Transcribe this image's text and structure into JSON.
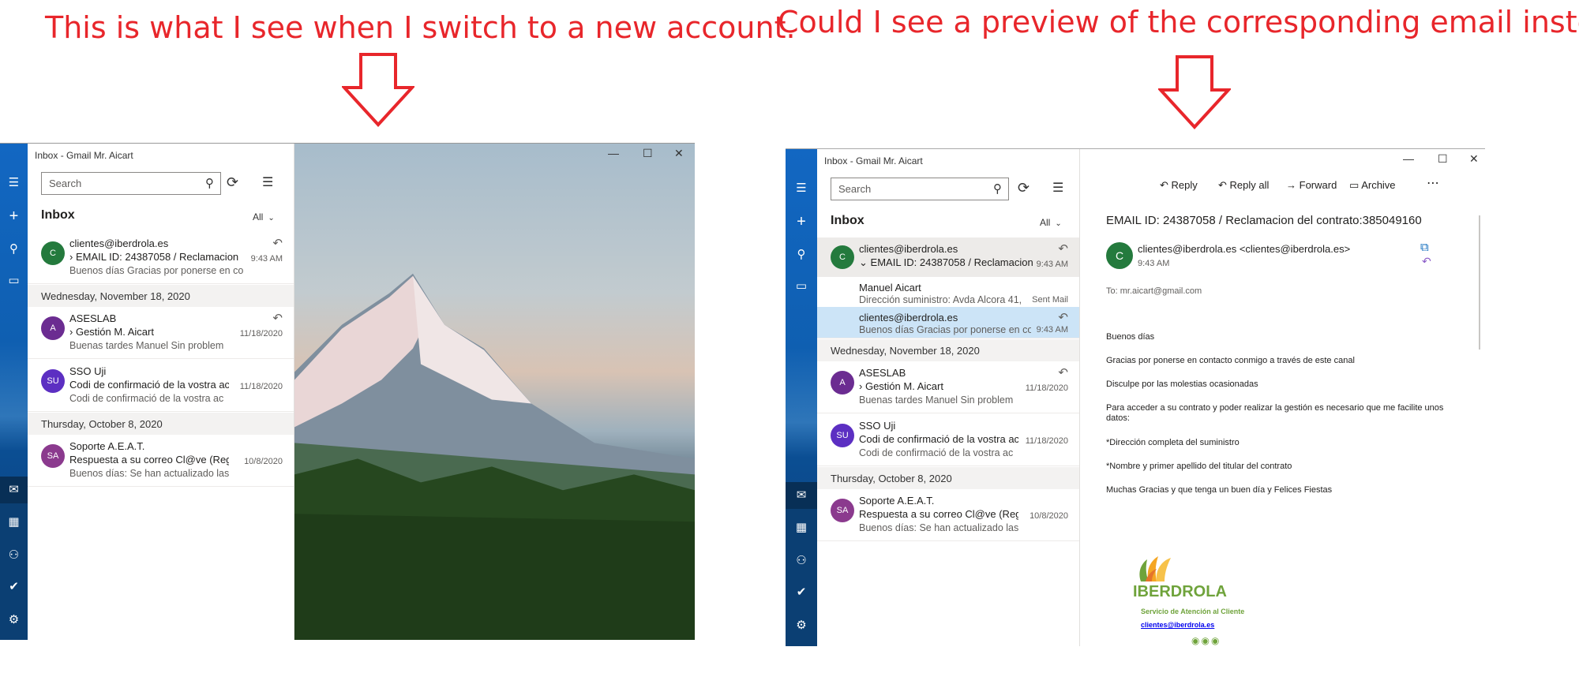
{
  "annotations": {
    "left": "This is what I see when I switch to a new account.",
    "right": "Could I see a preview of the corresponding email instead?"
  },
  "colors": {
    "annotation": "#e8262b",
    "accent": "#0f6cbd"
  },
  "window_title": "Inbox - Gmail Mr. Aicart",
  "search_placeholder": "Search",
  "folder_title": "Inbox",
  "filter_label": "All",
  "icons": [
    "hamburger-icon",
    "plus-icon",
    "person-icon",
    "folder-icon",
    "mail-icon",
    "calendar-icon",
    "people-icon",
    "todo-icon",
    "gear-icon",
    "search-icon",
    "sync-icon",
    "select-icon",
    "minimize-icon",
    "maximize-icon",
    "close-icon",
    "reply-icon",
    "chevron-icon"
  ],
  "groups": [
    "Wednesday, November 18, 2020",
    "Thursday, October 8, 2020"
  ],
  "left_list": [
    {
      "initial": "C",
      "color": "#247a3d",
      "sender": "clientes@iberdrola.es",
      "subject": "EMAIL ID: 24387058 / Reclamacion",
      "preview": "Buenos días Gracias por ponerse en co",
      "date": "9:43 AM",
      "expand": "›"
    },
    {
      "initial": "A",
      "color": "#6b2c91",
      "sender": "ASESLAB",
      "subject": "Gestión M. Aicart",
      "preview": "Buenas tardes Manuel Sin problem",
      "date": "11/18/2020",
      "expand": "›"
    },
    {
      "initial": "SU",
      "color": "#5c2fc2",
      "sender": "SSO Uji",
      "subject": "Codi de confirmació de la vostra ac",
      "preview": "Codi de confirmació de la vostra ac",
      "date": "11/18/2020"
    },
    {
      "initial": "SA",
      "color": "#8b3a8e",
      "sender": "Soporte A.E.A.T.",
      "subject": "Respuesta a su correo Cl@ve (Regist",
      "preview": "Buenos días: Se han actualizado las l",
      "date": "10/8/2020"
    }
  ],
  "right_list": {
    "thread_head": {
      "initial": "C",
      "color": "#247a3d",
      "sender": "clientes@iberdrola.es",
      "subject": "EMAIL ID: 24387058 / Reclamacion",
      "date": "9:43 AM",
      "expand": "⌄"
    },
    "thread_child1": {
      "sender": "Manuel Aicart",
      "preview": "Dirección suministro: Avda Alcora 41,",
      "date": "Sent Mail"
    },
    "thread_child2": {
      "sender": "clientes@iberdrola.es",
      "preview": "Buenos días Gracias por ponerse en co",
      "date": "9:43 AM"
    }
  },
  "reading": {
    "actions": [
      "Reply",
      "Reply all",
      "Forward",
      "Archive",
      "⋯"
    ],
    "subject": "EMAIL ID: 24387058 / Reclamacion del contrato:385049160",
    "from": "clientes@iberdrola.es <clientes@iberdrola.es>",
    "avatar": "C",
    "time": "9:43 AM",
    "to_label": "To:",
    "to": "mr.aicart@gmail.com",
    "body": [
      "Buenos días",
      "Gracias por ponerse en contacto conmigo a través de este canal",
      "Disculpe por las molestias ocasionadas",
      "Para acceder a su contrato y poder realizar la gestión es necesario que me facilite unos datos:",
      "*Dirección completa del suministro",
      "*Nombre y primer apellido del titular del contrato",
      "Muchas Gracias y que tenga un buen día y Felices Fiestas"
    ],
    "logo_text": "IBERDROLA",
    "signature": "Servicio de Atención al Cliente",
    "signature_link": "clientes@iberdrola.es"
  }
}
